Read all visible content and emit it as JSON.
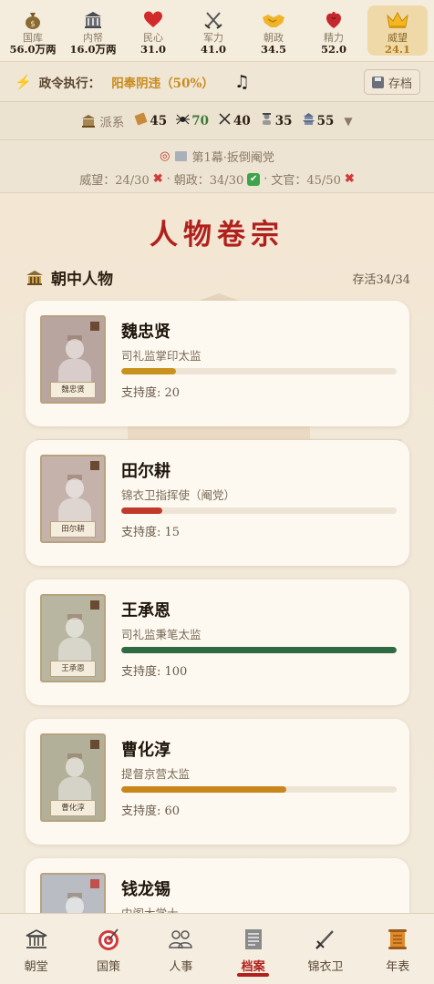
{
  "stats": [
    {
      "name": "treasury",
      "label": "国库",
      "value": "56.0万两",
      "icon": "money-bag-icon"
    },
    {
      "name": "inner-treasury",
      "label": "内帑",
      "value": "16.0万两",
      "icon": "bank-building-icon"
    },
    {
      "name": "public-morale",
      "label": "民心",
      "value": "31.0",
      "icon": "heart-icon"
    },
    {
      "name": "military",
      "label": "军力",
      "value": "41.0",
      "icon": "crossed-swords-icon"
    },
    {
      "name": "court-politics",
      "label": "朝政",
      "value": "34.5",
      "icon": "handshake-icon"
    },
    {
      "name": "energy",
      "label": "精力",
      "value": "52.0",
      "icon": "anatomical-heart-icon"
    },
    {
      "name": "prestige",
      "label": "威望",
      "value": "24.1",
      "icon": "crown-icon"
    }
  ],
  "policy": {
    "label": "政令执行：",
    "value": "阳奉阴违（50%）",
    "save_label": "存档"
  },
  "factions": {
    "title": "派系",
    "items": [
      {
        "value": "45",
        "icon": "scroll-icon"
      },
      {
        "value": "70",
        "icon": "spider-icon"
      },
      {
        "value": "40",
        "icon": "crossed-swords-icon"
      },
      {
        "value": "35",
        "icon": "scholar-icon"
      },
      {
        "value": "55",
        "icon": "pagoda-icon"
      }
    ]
  },
  "objective": {
    "act": "第1幕·扳倒阉党",
    "req1": "威望：24/30",
    "sep1": "·",
    "req2": "朝政：34/30",
    "sep2": "·",
    "req3": "文官：45/50"
  },
  "main": {
    "title": "人物卷宗",
    "section": "朝中人物",
    "alive": "存活34/34"
  },
  "characters": [
    {
      "name": "魏忠贤",
      "title": "司礼监掌印太监",
      "support_label": "支持度: 20",
      "support": 20,
      "color": "#c9921d",
      "tint": "#b9a5a0"
    },
    {
      "name": "田尔耕",
      "title": "锦衣卫指挥使（阉党）",
      "support_label": "支持度: 15",
      "support": 15,
      "color": "#c0392b",
      "tint": "#c4b2ab"
    },
    {
      "name": "王承恩",
      "title": "司礼监秉笔太监",
      "support_label": "支持度: 100",
      "support": 100,
      "color": "#2e6b43",
      "tint": "#b8b5a0"
    },
    {
      "name": "曹化淳",
      "title": "提督京营太监",
      "support_label": "支持度: 60",
      "support": 60,
      "color": "#c9861d",
      "tint": "#b3b09a"
    },
    {
      "name": "钱龙锡",
      "title": "内阁大学士",
      "support_label": "",
      "support": 0,
      "color": "#c9921d",
      "tint": "#b9bcc2"
    }
  ],
  "nav": [
    {
      "label": "朝堂",
      "icon": "palace-icon"
    },
    {
      "label": "国策",
      "icon": "target-icon"
    },
    {
      "label": "人事",
      "icon": "people-icon"
    },
    {
      "label": "档案",
      "icon": "document-icon",
      "active": true
    },
    {
      "label": "锦衣卫",
      "icon": "dagger-icon"
    },
    {
      "label": "年表",
      "icon": "scroll-icon"
    }
  ]
}
